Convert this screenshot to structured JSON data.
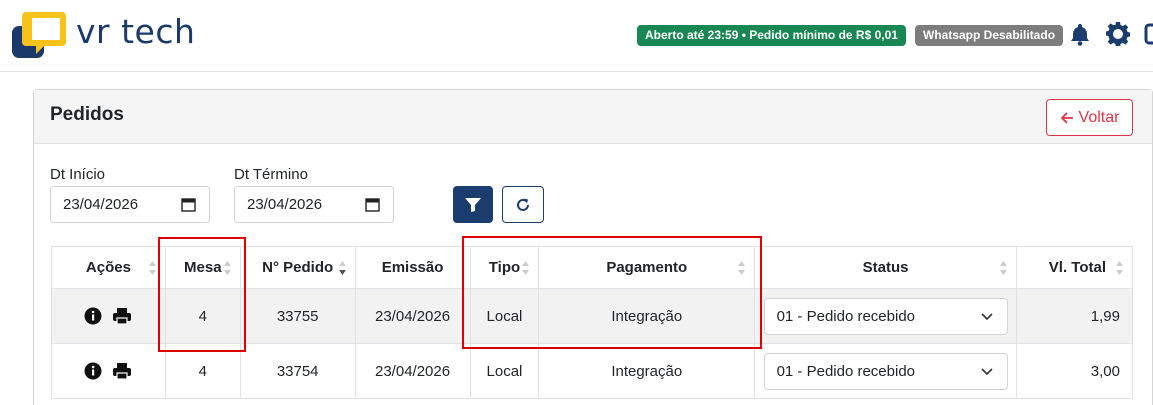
{
  "brand": {
    "name": "vr tech"
  },
  "header": {
    "status_badge": "Aberto até 23:59 • Pedido mínimo de R$ 0,01",
    "whatsapp_badge": "Whatsapp Desabilitado",
    "icons": [
      "bell-icon",
      "gear-icon"
    ]
  },
  "colors": {
    "brand": "#1b3a6b",
    "success": "#198754",
    "danger": "#dc3545",
    "highlight": "#e00000"
  },
  "card": {
    "title": "Pedidos",
    "back_label": "Voltar"
  },
  "filters": {
    "start_label": "Dt Início",
    "start_value": "23/04/2026",
    "end_label": "Dt Término",
    "end_value": "23/04/2026"
  },
  "table": {
    "columns": [
      "Ações",
      "Mesa",
      "N° Pedido",
      "Emissão",
      "Tipo",
      "Pagamento",
      "Status",
      "Vl. Total"
    ],
    "rows": [
      {
        "mesa": "4",
        "pedido": "33755",
        "emissao": "23/04/2026",
        "tipo": "Local",
        "pagamento": "Integração",
        "status": "01 - Pedido recebido",
        "total": "1,99"
      },
      {
        "mesa": "4",
        "pedido": "33754",
        "emissao": "23/04/2026",
        "tipo": "Local",
        "pagamento": "Integração",
        "status": "01 - Pedido recebido",
        "total": "3,00"
      }
    ]
  }
}
